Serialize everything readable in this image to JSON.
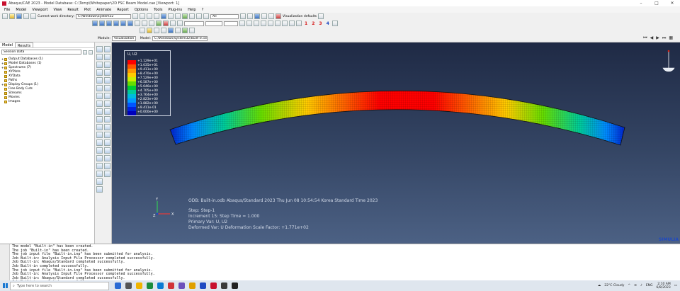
{
  "window": {
    "title": "Abaqus/CAE 2023 - Model Database: C:\\Temp\\Whitepaper\\2D FSC Beam Model.cae [Viewport: 1]"
  },
  "menu": [
    "File",
    "Model",
    "Viewport",
    "View",
    "Result",
    "Plot",
    "Animate",
    "Report",
    "Options",
    "Tools",
    "Plug-ins",
    "Help",
    "?"
  ],
  "toolbar": {
    "work_dir_label": "Current work directory:",
    "work_dir_value": "C:\\Windows\\System32",
    "all_label": "All",
    "visualization_defaults": "Visualization defaults",
    "step_numbers": [
      "1",
      "2",
      "3",
      "4"
    ]
  },
  "context_bar": {
    "module_label": "Module:",
    "module_value": "Visualization",
    "model_label": "Model:",
    "model_value": "C:/Windows/System32/Built-in.odb"
  },
  "left_panel": {
    "tabs": [
      "Model",
      "Results"
    ],
    "filter_placeholder": "Session Data",
    "tree": [
      {
        "label": "Output Databases (1)",
        "pm": "+"
      },
      {
        "label": "Model Databases (1)",
        "pm": "+"
      },
      {
        "label": "Spectrums (7)",
        "pm": "+"
      },
      {
        "label": "XYPlots",
        "pm": ""
      },
      {
        "label": "XYData",
        "pm": ""
      },
      {
        "label": "Paths",
        "pm": ""
      },
      {
        "label": "Display Groups (1)",
        "pm": "+"
      },
      {
        "label": "Free Body Cuts",
        "pm": ""
      },
      {
        "label": "Streams",
        "pm": ""
      },
      {
        "label": "Movies",
        "pm": ""
      },
      {
        "label": "Images",
        "pm": ""
      }
    ]
  },
  "legend": {
    "title": "U, U2",
    "labels": [
      "+1.129e+01",
      "+1.035e+01",
      "+9.411e+00",
      "+8.470e+00",
      "+7.529e+00",
      "+6.587e+00",
      "+5.646e+00",
      "+4.705e+00",
      "+3.764e+00",
      "+2.823e+00",
      "+1.882e+00",
      "+9.411e-01",
      "+0.000e+00"
    ],
    "colors": [
      "#ff0000",
      "#ff5500",
      "#ff9900",
      "#ffcc00",
      "#ccee00",
      "#66dd00",
      "#00cc33",
      "#00cc99",
      "#00bbdd",
      "#0099ff",
      "#0055ff",
      "#0022dd",
      "#0000bb"
    ]
  },
  "viewport_info": {
    "odb_line": "ODB: Built-in.odb    Abaqus/Standard 2023    Thu Jun 08 10:54:54 Korea Standard Time 2023",
    "step_line": "Step: Step-1",
    "increment_line": "Increment      15: Step Time =      1.000",
    "primary_var_line": "Primary Var: U, U2",
    "deformed_line": "Deformed Var: U   Deformation Scale Factor: +1.771e+02",
    "triad_axes": [
      "Y",
      "Z",
      "X"
    ]
  },
  "brand": "SIMULIA",
  "messages": [
    "The model \"Built-in\" has been created.",
    "The job \"Built-in\" has been created.",
    "The job input file \"Built-in.inp\" has been submitted for analysis.",
    "Job Built-in: Analysis Input File Processor completed successfully.",
    "Job Built-in: Abaqus/Standard completed successfully.",
    "Job Built-in completed successfully.",
    "The job input file \"Built-in.inp\" has been submitted for analysis.",
    "Job Built-in: Analysis Input File Processor completed successfully.",
    "Job Built-in: Abaqus/Standard completed successfully.",
    "Job Built-in completed successfully."
  ],
  "taskbar": {
    "search_placeholder": "Type here to search",
    "icon_colors": [
      "#2a6bd4",
      "#555555",
      "#f0b400",
      "#1b8c3c",
      "#0a7bd4",
      "#d13438",
      "#6b4fbb",
      "#e0a000",
      "#1f49c2",
      "#c8102e",
      "#3a3a3a",
      "#222222"
    ],
    "weather": "22°C  Cloudy",
    "language": "ENG",
    "time": "2:10 AM",
    "date": "6/8/2023"
  }
}
